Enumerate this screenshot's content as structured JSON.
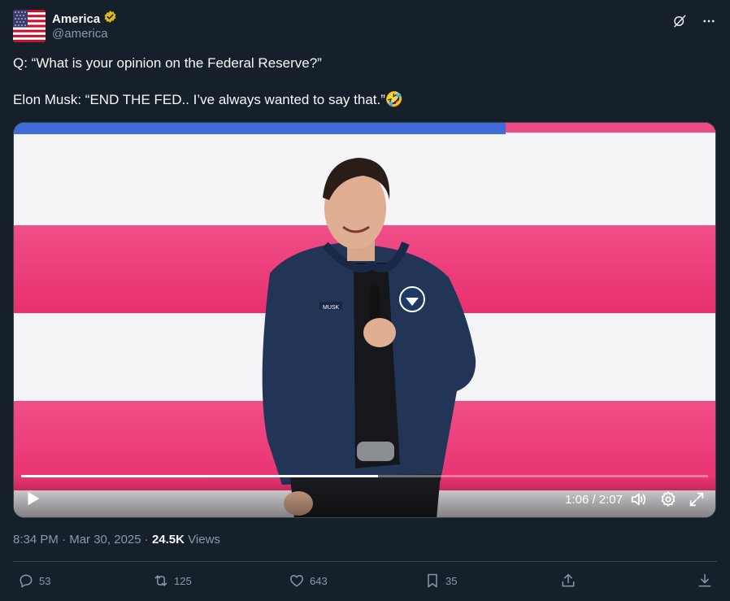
{
  "author": {
    "name": "America",
    "handle": "@america",
    "verified_badge_color": "#e2b719"
  },
  "icons": {
    "grok": "grok-icon",
    "more": "more-icon"
  },
  "tweet": {
    "line1": "Q: “What is your opinion on the Federal Reserve?”",
    "line2": "Elon Musk: “END THE FED.. I’ve always wanted to say that.”",
    "emoji": "🤣"
  },
  "video": {
    "badge_text": "MUSK",
    "current_time": "1:06",
    "duration": "2:07",
    "time_display": "1:06 / 2:07",
    "progress_fraction": 0.52
  },
  "meta": {
    "time": "8:34 PM",
    "date": "Mar 30, 2025",
    "views_count": "24.5K",
    "views_label": "Views"
  },
  "actions": {
    "replies": "53",
    "reposts": "125",
    "likes": "643",
    "bookmarks": "35"
  },
  "colors": {
    "background": "#15202b",
    "muted_text": "#8b98a5",
    "flag_pink": "#ef3d7a",
    "flag_blue": "#3f6ad8"
  }
}
